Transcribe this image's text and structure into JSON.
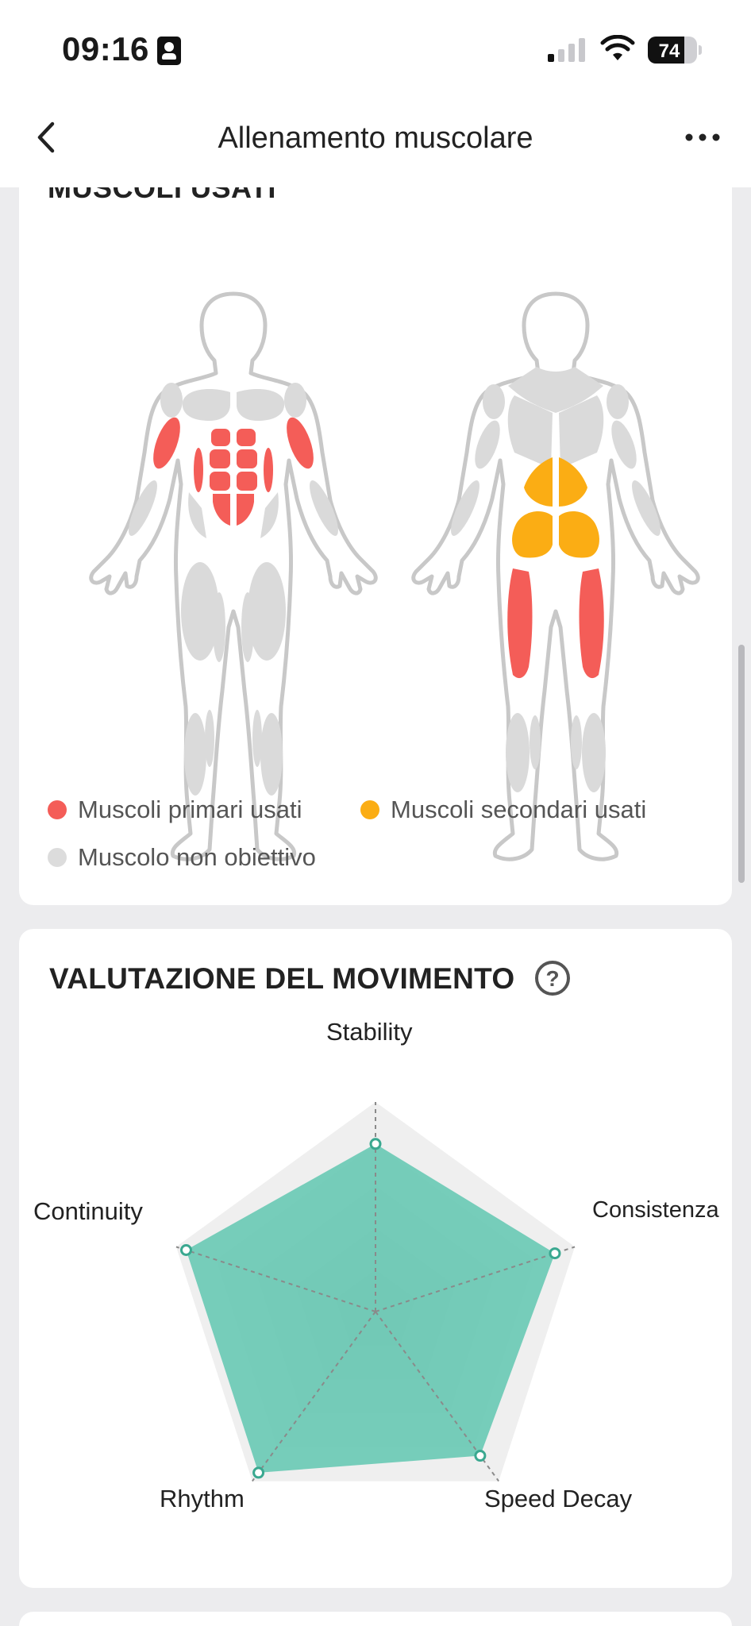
{
  "status_bar": {
    "time": "09:16",
    "battery": "74"
  },
  "nav": {
    "title": "Allenamento muscolare"
  },
  "muscles_card": {
    "title": "MUSCOLI USATI",
    "legend": [
      {
        "label": "Muscoli primari usati",
        "color": "#f45d58"
      },
      {
        "label": "Muscoli secondari usati",
        "color": "#fbad14"
      },
      {
        "label": "Muscolo non obiettivo",
        "color": "#dcdcdc"
      }
    ]
  },
  "movement_card": {
    "title": "VALUTAZIONE DEL MOVIMENTO",
    "help": "?",
    "radar": {
      "axes": [
        "Stability",
        "Consistenza",
        "Speed Decay",
        "Rhythm",
        "Continuity"
      ],
      "values": [
        0.8,
        0.9,
        0.85,
        0.95,
        0.95
      ],
      "fill_color": "#5cc6ae"
    }
  }
}
